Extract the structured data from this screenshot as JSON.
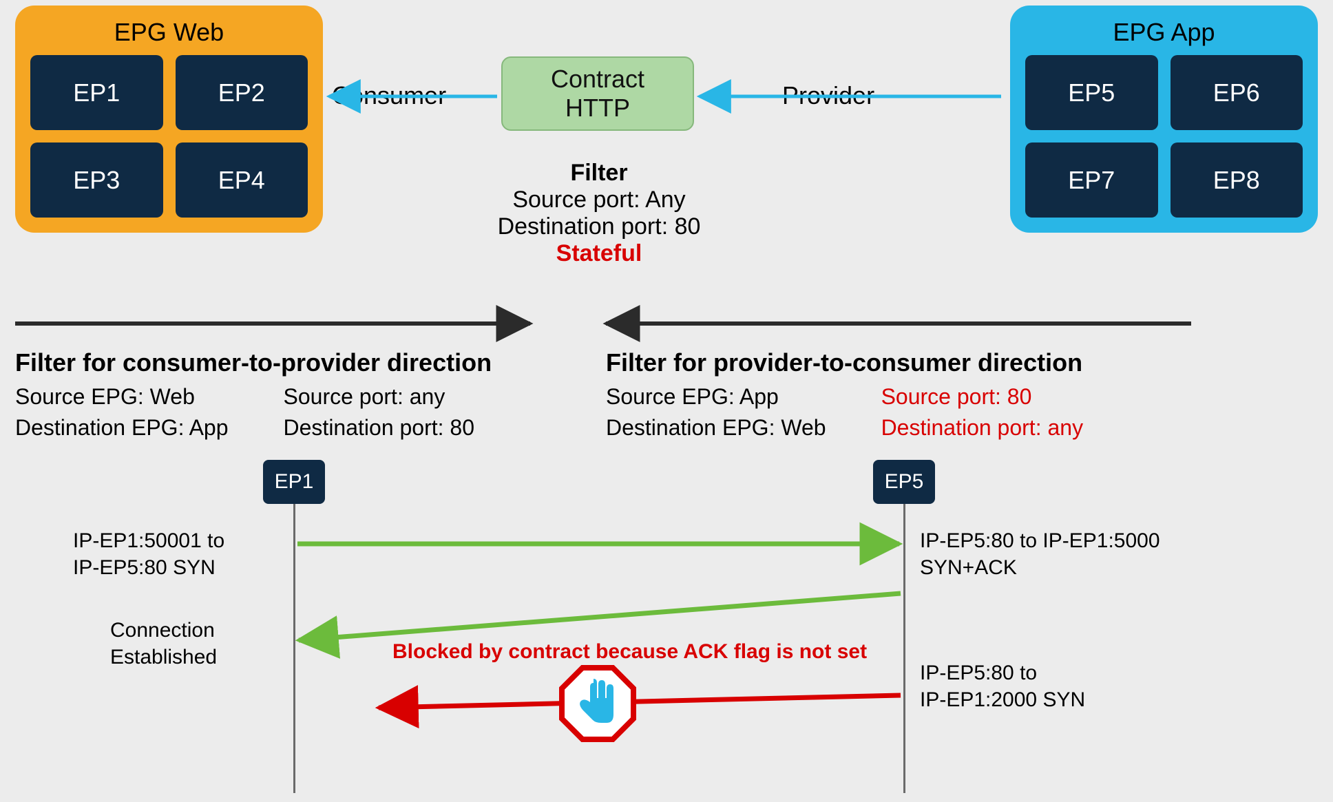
{
  "epg_web": {
    "title": "EPG Web",
    "endpoints": [
      "EP1",
      "EP2",
      "EP3",
      "EP4"
    ]
  },
  "epg_app": {
    "title": "EPG App",
    "endpoints": [
      "EP5",
      "EP6",
      "EP7",
      "EP8"
    ]
  },
  "consumer_label": "Consumer",
  "provider_label": "Provider",
  "contract": {
    "line1": "Contract",
    "line2": "HTTP"
  },
  "filter": {
    "title": "Filter",
    "source": "Source port: Any",
    "dest": "Destination port: 80",
    "stateful": "Stateful"
  },
  "consumer_filter": {
    "title": "Filter for consumer-to-provider direction",
    "col1_line1": "Source EPG: Web",
    "col1_line2": "Destination EPG: App",
    "col2_line1": "Source port: any",
    "col2_line2": "Destination port: 80"
  },
  "provider_filter": {
    "title": "Filter for provider-to-consumer direction",
    "col1_line1": "Source EPG: App",
    "col1_line2": "Destination EPG: Web",
    "col2_line1": "Source port: 80",
    "col2_line2": "Destination port: any"
  },
  "nodes": {
    "ep1": "EP1",
    "ep5": "EP5"
  },
  "flows": {
    "a1_line1": "IP-EP1:50001 to",
    "a1_line2": "IP-EP5:80 SYN",
    "a2_line1": "IP-EP5:80 to IP-EP1:5000",
    "a2_line2": "SYN+ACK",
    "b_line1": "Connection",
    "b_line2": "Established",
    "c_line1": "IP-EP5:80 to",
    "c_line2": "IP-EP1:2000 SYN",
    "blocked": "Blocked by contract because ACK flag is not set"
  }
}
